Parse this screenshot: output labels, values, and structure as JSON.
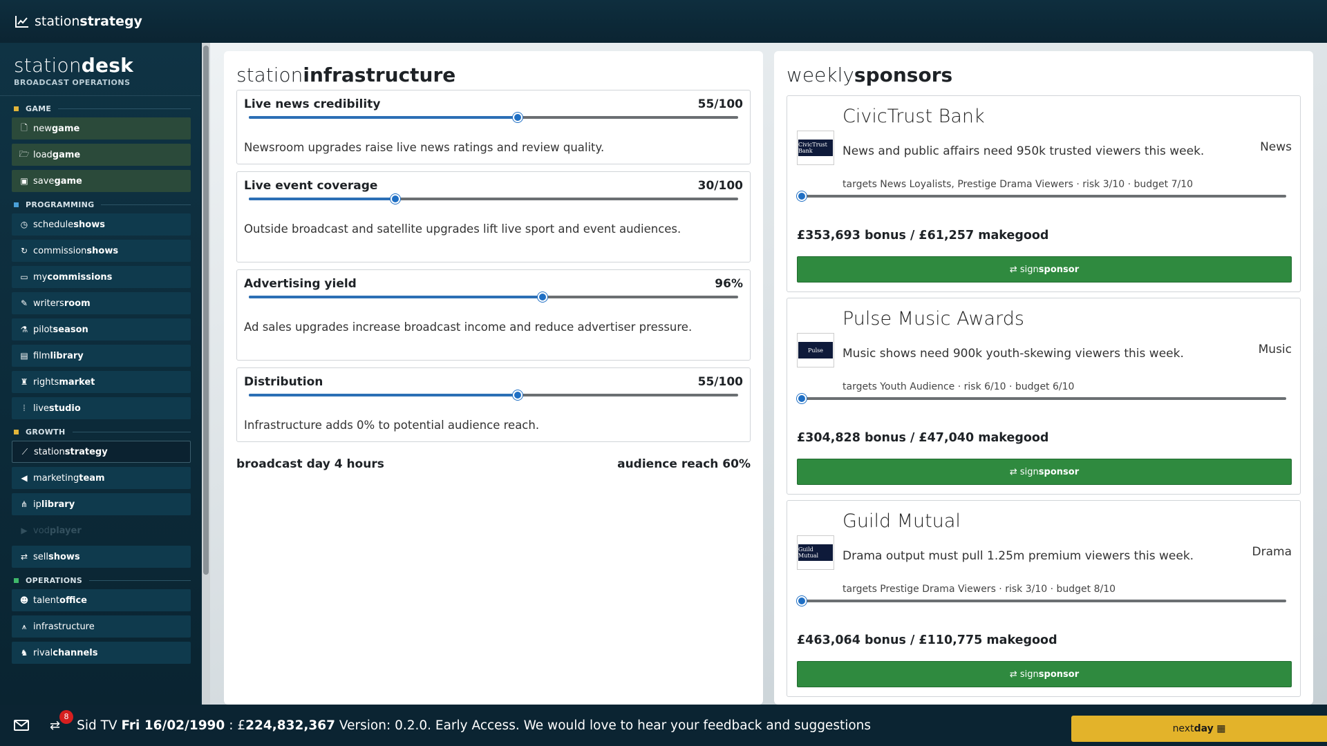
{
  "topbar": {
    "title_light": "station",
    "title_bold": "strategy"
  },
  "sidebar": {
    "brand_light": "station",
    "brand_bold": "desk",
    "subtitle": "BROADCAST OPERATIONS",
    "sections": {
      "game": {
        "label": "GAME",
        "color": "#e2b53a"
      },
      "programming": {
        "label": "PROGRAMMING",
        "color": "#4aa0d8"
      },
      "growth": {
        "label": "GROWTH",
        "color": "#e2b53a"
      },
      "operations": {
        "label": "OPERATIONS",
        "color": "#3fb86a"
      }
    },
    "items": {
      "newgame": {
        "a": "new",
        "b": "game",
        "icon": "file-icon"
      },
      "loadgame": {
        "a": "load",
        "b": "game",
        "icon": "folder-icon"
      },
      "savegame": {
        "a": "save",
        "b": "game",
        "icon": "floppy-icon"
      },
      "scheduleshows": {
        "a": "schedule",
        "b": "shows",
        "icon": "clock-icon"
      },
      "commissionshows": {
        "a": "commission",
        "b": "shows",
        "icon": "refresh-icon"
      },
      "mycommissions": {
        "a": "my",
        "b": "commissions",
        "icon": "monitor-icon"
      },
      "writersroom": {
        "a": "writers",
        "b": "room",
        "icon": "pen-icon"
      },
      "pilotseason": {
        "a": "pilot",
        "b": "season",
        "icon": "flask-icon"
      },
      "filmlibrary": {
        "a": "film",
        "b": "library",
        "icon": "film-icon"
      },
      "rightsmarket": {
        "a": "rights",
        "b": "market",
        "icon": "trophy-icon"
      },
      "livestudio": {
        "a": "live",
        "b": "studio",
        "icon": "broadcast-icon"
      },
      "stationstrategy": {
        "a": "station",
        "b": "strategy",
        "icon": "chart-line-icon"
      },
      "marketingteam": {
        "a": "marketing",
        "b": "team",
        "icon": "megaphone-icon"
      },
      "iplibrary": {
        "a": "ip",
        "b": "library",
        "icon": "network-icon"
      },
      "vodplayer": {
        "a": "vod",
        "b": "player",
        "icon": "play-icon"
      },
      "sellshows": {
        "a": "sell",
        "b": "shows",
        "icon": "handshake-icon"
      },
      "talentoffice": {
        "a": "talent",
        "b": "office",
        "icon": "users-icon"
      },
      "infrastructure": {
        "a": "infrastructure",
        "b": "",
        "icon": "tower-icon"
      },
      "rivalchannels": {
        "a": "rival",
        "b": "channels",
        "icon": "chess-icon"
      }
    }
  },
  "infrastructure": {
    "title_light": "station",
    "title_bold": "infrastructure",
    "cards": [
      {
        "label": "Live news credibility",
        "value": "55/100",
        "level": 0.55,
        "desc": "Newsroom upgrades raise live news ratings and review quality."
      },
      {
        "label": "Live event coverage",
        "value": "30/100",
        "level": 0.3,
        "desc": "Outside broadcast and satellite upgrades lift live sport and event audiences."
      },
      {
        "label": "Advertising yield",
        "value": "96%",
        "level": 0.6,
        "desc": "Ad sales upgrades increase broadcast income and reduce advertiser pressure."
      },
      {
        "label": "Distribution",
        "value": "55/100",
        "level": 0.55,
        "desc": "Infrastructure adds 0% to potential audience reach."
      }
    ],
    "footer_left": "broadcast day 4 hours",
    "footer_right": "audience reach 60%"
  },
  "sponsors": {
    "title_light": "weekly",
    "title_bold": "sponsors",
    "button_a": "sign",
    "button_b": "sponsor",
    "cards": [
      {
        "name": "CivicTrust Bank",
        "logo": "CivicTrust Bank",
        "desc": "News and public affairs need 950k trusted viewers this week.",
        "genre": "News",
        "targets": "targets News Loyalists, Prestige Drama Viewers · risk 3/10 · budget 7/10",
        "bonus": "£353,693 bonus / £61,257 makegood"
      },
      {
        "name": "Pulse Music Awards",
        "logo": "Pulse",
        "desc": "Music shows need 900k youth-skewing viewers this week.",
        "genre": "Music",
        "targets": "targets Youth Audience · risk 6/10 · budget 6/10",
        "bonus": "£304,828 bonus / £47,040 makegood"
      },
      {
        "name": "Guild Mutual",
        "logo": "Guild Mutual",
        "desc": "Drama output must pull 1.25m premium viewers this week.",
        "genre": "Drama",
        "targets": "targets Prestige Drama Viewers · risk 3/10 · budget 8/10",
        "bonus": "£463,064 bonus / £110,775 makegood"
      }
    ]
  },
  "statusbar": {
    "badge": "8",
    "channel": "Sid TV",
    "date": "Fri 16/02/1990",
    "sep": ":",
    "money": "£224,832,367",
    "message": "Version: 0.2.0. Early Access. We would love to hear your feedback and suggestions",
    "next_a": "next",
    "next_b": "day"
  },
  "colors": {
    "accent": "#1f6fc4",
    "sponsor_button": "#2f8a3f",
    "nextday": "#e3b32a",
    "badge": "#d61f1f"
  }
}
